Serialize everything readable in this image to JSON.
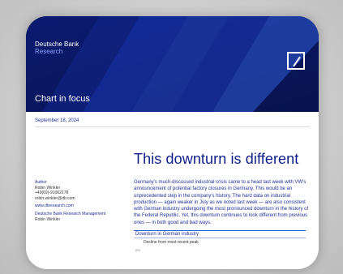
{
  "brand": {
    "name": "Deutsche Bank",
    "unit": "Research"
  },
  "banner": {
    "section_title": "Chart in focus"
  },
  "date": "September 18, 2024",
  "headline": "This downturn is different",
  "sidebar": {
    "author_label": "Author",
    "author_name": "Robin Winkler",
    "phone": "+49(69)-91062178",
    "email": "robin.winkler@db.com",
    "website": "www.dbresearch.com",
    "management_label": "Deutsche Bank Research Management",
    "management_name": "Robin Winkler"
  },
  "body": "Germany's much-discussed industrial crisis came to a head last week with VW's announcement of potential factory closures in Germany. This would be an unprecedented step in the company's history. The hard data on industrial production — again weaker in July as we noted last week — are also consistent with German industry undergoing the most pronounced downturn in the history of the Federal Republic. Yet, this downturn continues to look different from previous ones — in both good and bad ways.",
  "chart": {
    "title": "Downturn in German industry",
    "subtitle": "Decline from most recent peak",
    "tick": "0%"
  },
  "colors": {
    "navy": "#0a1a6e",
    "accent_blue": "#1f2f9a"
  }
}
